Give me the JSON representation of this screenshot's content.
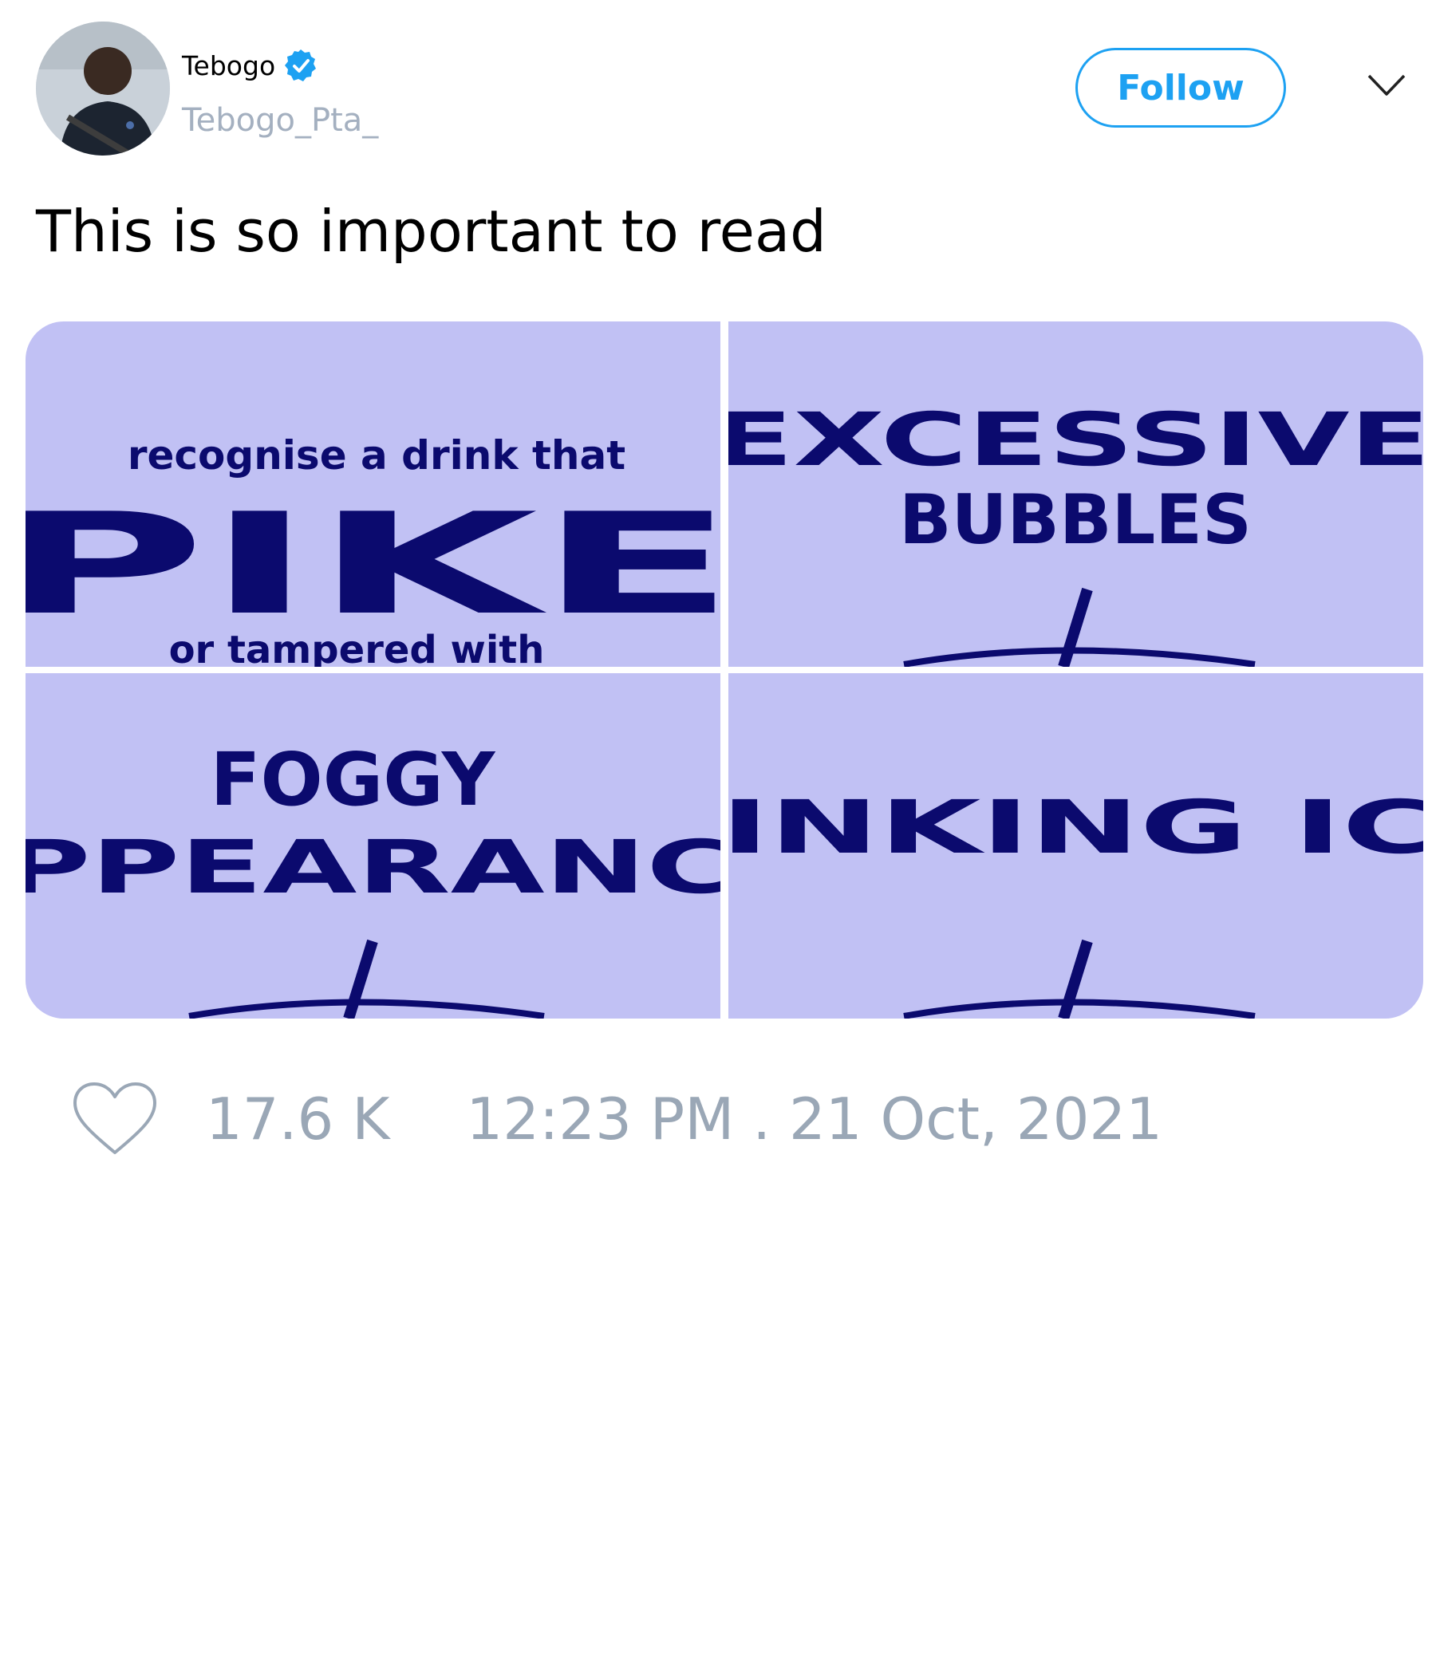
{
  "tweet": {
    "author_name": "Tebogo",
    "handle": "Tebogo_Pta_",
    "follow_label": "Follow",
    "text": "This is so important to read"
  },
  "media": {
    "tiles": [
      {
        "line1": "recognise a drink that",
        "line2": "PIKE",
        "line3": "or tampered with"
      },
      {
        "line1": "EXCESSIVE",
        "line2": "BUBBLES"
      },
      {
        "line1": "FOGGY",
        "line2": "PPEARANC"
      },
      {
        "line1": "INKING IC"
      }
    ]
  },
  "footer": {
    "likes": "17.6 K",
    "timestamp": "12:23 PM . 21 Oct, 2021"
  },
  "colors": {
    "accent": "#1da1f2",
    "muted": "#9aa7b6",
    "poster_bg": "#c1c1f4",
    "poster_text": "#0b0a6e"
  },
  "icons": [
    "verified-badge-icon",
    "chevron-down-icon",
    "heart-icon"
  ]
}
